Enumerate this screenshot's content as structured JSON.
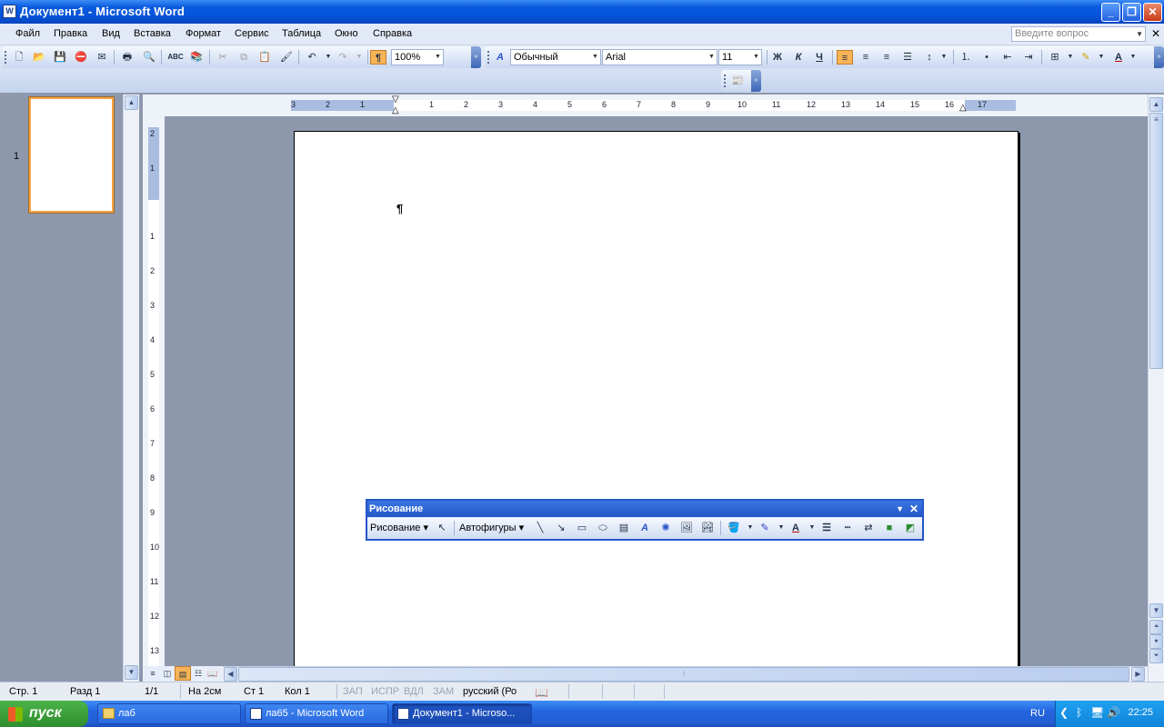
{
  "window": {
    "title": "Документ1 - Microsoft Word"
  },
  "menu": [
    "Файл",
    "Правка",
    "Вид",
    "Вставка",
    "Формат",
    "Сервис",
    "Таблица",
    "Окно",
    "Справка"
  ],
  "help_placeholder": "Введите вопрос",
  "toolbar": {
    "zoom": "100%",
    "style": "Обычный",
    "font": "Arial",
    "size": "11",
    "bold": "Ж",
    "italic": "К",
    "underline": "Ч",
    "font_color_letter": "A"
  },
  "ruler": {
    "h_labels": [
      "3",
      "2",
      "1",
      "1",
      "2",
      "3",
      "4",
      "5",
      "6",
      "7",
      "8",
      "9",
      "10",
      "11",
      "12",
      "13",
      "14",
      "15",
      "16",
      "17"
    ],
    "v_labels": [
      "2",
      "1",
      "1",
      "2",
      "3",
      "4",
      "5",
      "6",
      "7",
      "8",
      "9",
      "10",
      "11",
      "12",
      "13"
    ]
  },
  "thumbnail": {
    "page_number": "1"
  },
  "document": {
    "cursor_glyph": "¶"
  },
  "drawing_toolbar": {
    "title": "Рисование",
    "draw_menu": "Рисование",
    "autoshapes": "Автофигуры",
    "font_color_letter": "A"
  },
  "status": {
    "page": "Стр. 1",
    "section": "Разд 1",
    "pages": "1/1",
    "at": "На 2см",
    "line": "Ст 1",
    "col": "Кол 1",
    "rec": "ЗАП",
    "trk": "ИСПР",
    "ext": "ВДЛ",
    "ovr": "ЗАМ",
    "language": "русский (Ро"
  },
  "taskbar": {
    "start": "пуск",
    "tasks": [
      "лаб",
      "ла65 - Microsoft Word",
      "Документ1 - Microso..."
    ],
    "lang": "RU",
    "clock": "22:25"
  },
  "colors": {
    "accent": "#0553d8",
    "highlight": "#f7b457",
    "page_bg": "#8d98ad"
  }
}
